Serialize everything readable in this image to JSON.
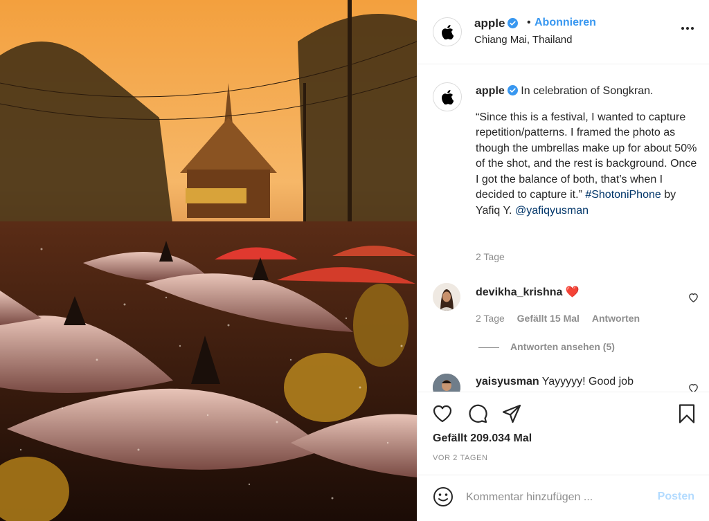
{
  "header": {
    "username": "apple",
    "dot": "•",
    "follow_label": "Abonnieren",
    "location": "Chiang Mai, Thailand"
  },
  "caption": {
    "username": "apple",
    "first_line": "In celebration of Songkran.",
    "body": "“Since this is a festival, I wanted to capture repetition/patterns. I framed the photo as though the umbrellas make up for about 50% of the shot, and the rest is background. Once I got the balance of both, that’s when I decided to capture it.”",
    "hashtag": "#ShotoniPhone",
    "by": "by Yafiq Y.",
    "mention": "@yafiqyusman",
    "time": "2 Tage"
  },
  "comments": [
    {
      "username": "devikha_krishna",
      "text": "❤️",
      "time": "2 Tage",
      "likes": "Gefällt 15 Mal",
      "reply_label": "Antworten",
      "view_replies": "Antworten ansehen (5)"
    },
    {
      "username": "yaisyusman",
      "text": "Yayyyyy! Good job"
    }
  ],
  "actions": {
    "likes": "Gefällt 209.034 Mal",
    "post_time": "VOR 2 TAGEN"
  },
  "add_comment": {
    "placeholder": "Kommentar hinzufügen ...",
    "post_label": "Posten"
  },
  "colors": {
    "accent": "#3897f0",
    "link": "#003569",
    "muted": "#8e8e8e",
    "post_disabled": "#b3dbff",
    "heart": "#ed4956"
  },
  "icons": [
    "apple-logo-icon",
    "verified-badge-icon",
    "more-options-icon",
    "heart-icon",
    "comment-icon",
    "share-icon",
    "bookmark-icon",
    "emoji-icon"
  ]
}
